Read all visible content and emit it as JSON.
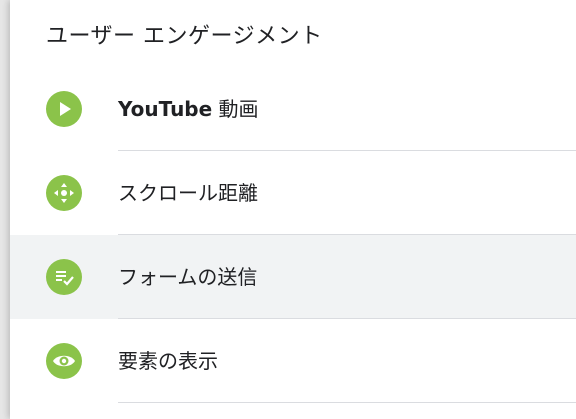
{
  "section": {
    "title": "ユーザー エンゲージメント"
  },
  "items": [
    {
      "label_bold": "YouTube",
      "label_rest": " 動画",
      "icon": "play-icon"
    },
    {
      "label": "スクロール距離",
      "icon": "move-arrows-icon"
    },
    {
      "label": "フォームの送信",
      "icon": "form-check-icon"
    },
    {
      "label": "要素の表示",
      "icon": "eye-icon"
    }
  ],
  "colors": {
    "icon_bg": "#8bc34a",
    "highlight_bg": "#f1f3f4",
    "divider": "#dadce0",
    "text": "#202124"
  }
}
